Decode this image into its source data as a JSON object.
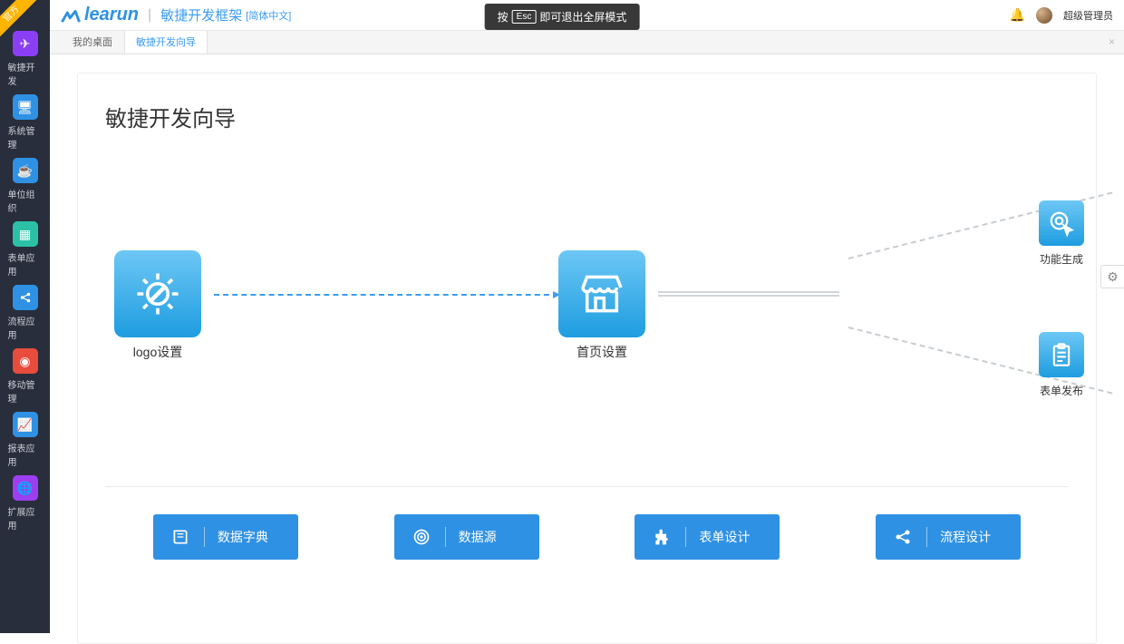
{
  "ribbon": "官方",
  "brand": "learun",
  "header": {
    "title": "敏捷开发框架",
    "lang": "[简体中文]",
    "user": "超级管理员"
  },
  "esc": {
    "pre": "按",
    "key": "Esc",
    "post": "即可退出全屏模式"
  },
  "sidebar": [
    {
      "label": "敏捷开发",
      "color": "#8b3ff5"
    },
    {
      "label": "系统管理",
      "color": "#2f91e4"
    },
    {
      "label": "单位组织",
      "color": "#2f91e4"
    },
    {
      "label": "表单应用",
      "color": "#2cc1a7"
    },
    {
      "label": "流程应用",
      "color": "#2f91e4"
    },
    {
      "label": "移动管理",
      "color": "#e74c3c"
    },
    {
      "label": "报表应用",
      "color": "#2f91e4"
    },
    {
      "label": "扩展应用",
      "color": "#9b3ff0"
    }
  ],
  "tabs": [
    {
      "label": "我的桌面",
      "active": false
    },
    {
      "label": "敏捷开发向导",
      "active": true
    }
  ],
  "wizard": {
    "title": "敏捷开发向导",
    "nodes": {
      "logo": "logo设置",
      "home": "首页设置",
      "gen": "功能生成",
      "form": "表单发布"
    },
    "buttons": [
      {
        "label": "数据字典"
      },
      {
        "label": "数据源"
      },
      {
        "label": "表单设计"
      },
      {
        "label": "流程设计"
      }
    ]
  }
}
